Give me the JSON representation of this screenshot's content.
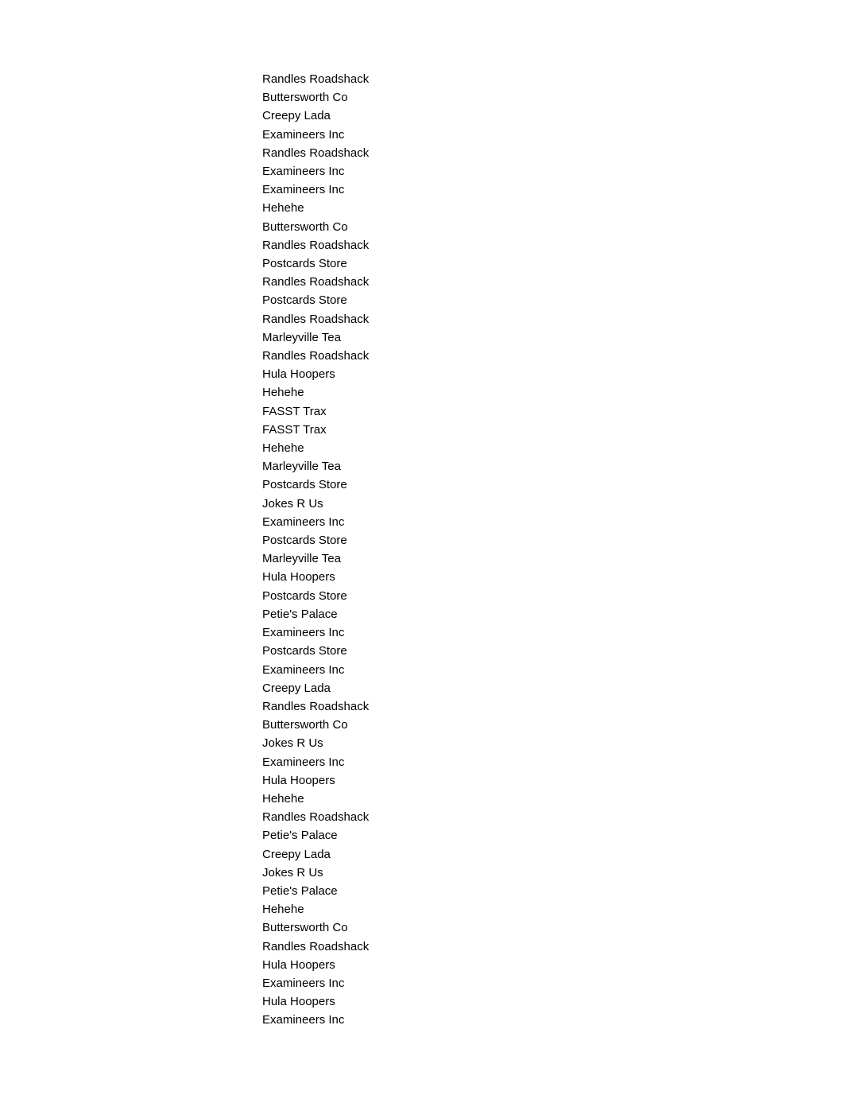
{
  "items": [
    "Randles Roadshack",
    "Buttersworth Co",
    "Creepy Lada",
    "Examineers Inc",
    "Randles Roadshack",
    "Examineers Inc",
    "Examineers Inc",
    "Hehehe",
    "Buttersworth Co",
    "Randles Roadshack",
    "Postcards Store",
    "Randles Roadshack",
    "Postcards Store",
    "Randles Roadshack",
    "Marleyville Tea",
    "Randles Roadshack",
    "Hula Hoopers",
    "Hehehe",
    "FASST Trax",
    "FASST Trax",
    "Hehehe",
    "Marleyville Tea",
    "Postcards Store",
    "Jokes R Us",
    "Examineers Inc",
    "Postcards Store",
    "Marleyville Tea",
    "Hula Hoopers",
    "Postcards Store",
    "Petie's Palace",
    "Examineers Inc",
    "Postcards Store",
    "Examineers Inc",
    "Creepy Lada",
    "Randles Roadshack",
    "Buttersworth Co",
    "Jokes R Us",
    "Examineers Inc",
    "Hula Hoopers",
    "Hehehe",
    "Randles Roadshack",
    "Petie's Palace",
    "Creepy Lada",
    "Jokes R Us",
    "Petie's Palace",
    "Hehehe",
    "Buttersworth Co",
    "Randles Roadshack",
    "Hula Hoopers",
    "Examineers Inc",
    "Hula Hoopers",
    "Examineers Inc"
  ]
}
